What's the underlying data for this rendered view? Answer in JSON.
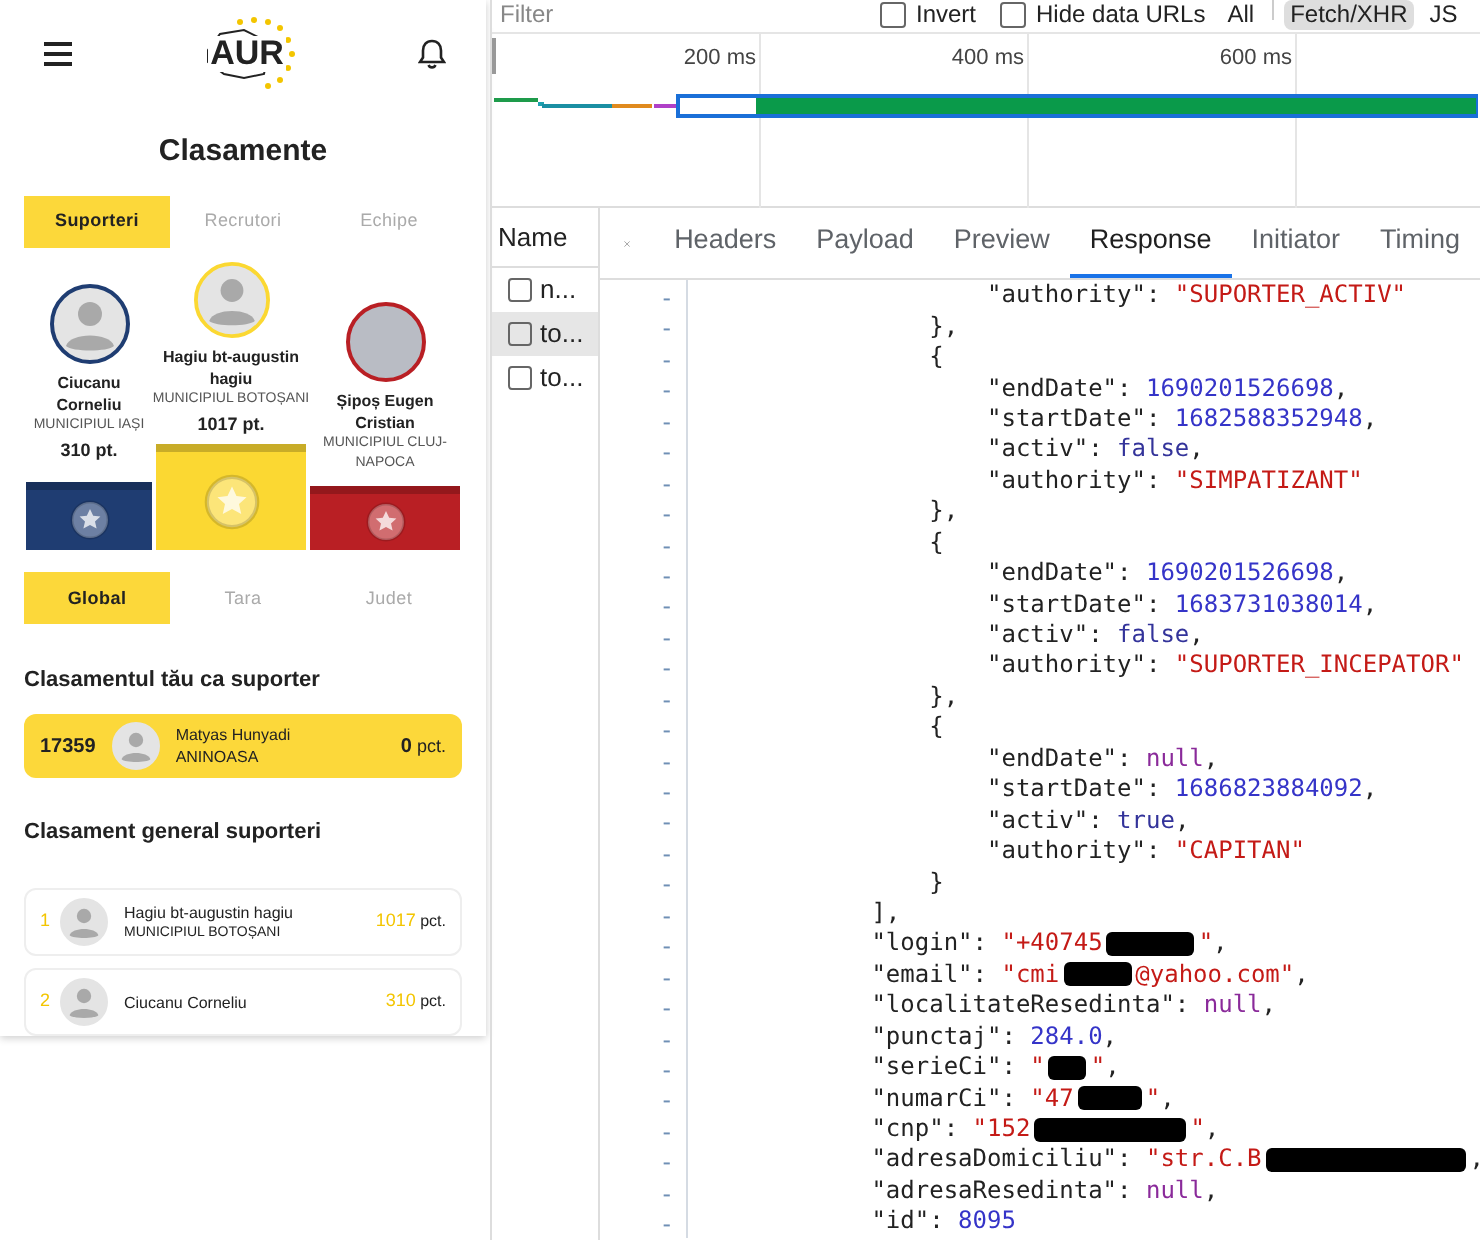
{
  "app": {
    "logo_text": "AUR",
    "title": "Clasamente",
    "category_tabs": [
      {
        "label": "Suporteri",
        "selected": true
      },
      {
        "label": "Recrutori",
        "selected": false
      },
      {
        "label": "Echipe",
        "selected": false
      }
    ],
    "podium": [
      {
        "name": "Ciucanu Corneliu",
        "city": "MUNICIPIUL IAȘI",
        "points": "310 pt.",
        "color": "#1f3d72",
        "kind": "silhouette"
      },
      {
        "name": "Hagiu bt-augustin hagiu",
        "city": "MUNICIPIUL BOTOȘANI",
        "points": "1017 pt.",
        "color": "#fbd832",
        "kind": "silhouette"
      },
      {
        "name": "Șipoș Eugen Cristian",
        "city": "MUNICIPIUL CLUJ-NAPOCA",
        "color": "#b91f24",
        "kind": "photo"
      }
    ],
    "scope_tabs": [
      {
        "label": "Global",
        "selected": true
      },
      {
        "label": "Tara",
        "selected": false
      },
      {
        "label": "Judet",
        "selected": false
      }
    ],
    "my_rank": {
      "heading": "Clasamentul tău ca suporter",
      "rank": "17359",
      "name": "Matyas Hunyadi",
      "city": "ANINOASA",
      "score": "0",
      "unit": "pct."
    },
    "general": {
      "heading": "Clasament general suporteri",
      "rows": [
        {
          "rank": "1",
          "name": "Hagiu bt-augustin hagiu",
          "city": "MUNICIPIUL BOTOȘANI",
          "score": "1017",
          "unit": "pct."
        },
        {
          "rank": "2",
          "name": "Ciucanu Corneliu",
          "score": "310",
          "unit": "pct."
        }
      ]
    }
  },
  "devtools": {
    "filter": {
      "placeholder": "Filter"
    },
    "checkboxes": [
      {
        "label": "Invert",
        "checked": false
      },
      {
        "label": "Hide data URLs",
        "checked": false
      }
    ],
    "type_filters": [
      {
        "label": "All",
        "selected": false
      },
      {
        "label": "Fetch/XHR",
        "selected": true
      },
      {
        "label": "JS",
        "selected": false
      }
    ],
    "overview": {
      "ticks": [
        "200 ms",
        "400 ms",
        "600 ms"
      ]
    },
    "requests_header": "Name",
    "requests": [
      {
        "label": "n...",
        "selected": false
      },
      {
        "label": "to...",
        "selected": true
      },
      {
        "label": "to...",
        "selected": false
      }
    ],
    "detail_tabs": [
      {
        "label": "Headers",
        "selected": false
      },
      {
        "label": "Payload",
        "selected": false
      },
      {
        "label": "Preview",
        "selected": false
      },
      {
        "label": "Response",
        "selected": true
      },
      {
        "label": "Initiator",
        "selected": false
      },
      {
        "label": "Timing",
        "selected": false
      }
    ],
    "response_lines": [
      {
        "marker": "-",
        "tokens": [
          {
            "kind": "key",
            "text": "                    \"authority\""
          },
          {
            "kind": "punct",
            "text": ": "
          },
          {
            "kind": "string",
            "text": "\"SUPORTER_ACTIV\""
          }
        ]
      },
      {
        "marker": "-",
        "tokens": [
          {
            "kind": "punct",
            "text": "                },"
          }
        ]
      },
      {
        "marker": "-",
        "tokens": [
          {
            "kind": "punct",
            "text": "                {"
          }
        ]
      },
      {
        "marker": "-",
        "tokens": [
          {
            "kind": "key",
            "text": "                    \"endDate\""
          },
          {
            "kind": "punct",
            "text": ": "
          },
          {
            "kind": "number",
            "text": "1690201526698"
          },
          {
            "kind": "punct",
            "text": ","
          }
        ]
      },
      {
        "marker": "-",
        "tokens": [
          {
            "kind": "key",
            "text": "                    \"startDate\""
          },
          {
            "kind": "punct",
            "text": ": "
          },
          {
            "kind": "number",
            "text": "1682588352948"
          },
          {
            "kind": "punct",
            "text": ","
          }
        ]
      },
      {
        "marker": "-",
        "tokens": [
          {
            "kind": "key",
            "text": "                    \"activ\""
          },
          {
            "kind": "punct",
            "text": ": "
          },
          {
            "kind": "boolean",
            "text": "false"
          },
          {
            "kind": "punct",
            "text": ","
          }
        ]
      },
      {
        "marker": "-",
        "tokens": [
          {
            "kind": "key",
            "text": "                    \"authority\""
          },
          {
            "kind": "punct",
            "text": ": "
          },
          {
            "kind": "string",
            "text": "\"SIMPATIZANT\""
          }
        ]
      },
      {
        "marker": "-",
        "tokens": [
          {
            "kind": "punct",
            "text": "                },"
          }
        ]
      },
      {
        "marker": "-",
        "tokens": [
          {
            "kind": "punct",
            "text": "                {"
          }
        ]
      },
      {
        "marker": "-",
        "tokens": [
          {
            "kind": "key",
            "text": "                    \"endDate\""
          },
          {
            "kind": "punct",
            "text": ": "
          },
          {
            "kind": "number",
            "text": "1690201526698"
          },
          {
            "kind": "punct",
            "text": ","
          }
        ]
      },
      {
        "marker": "-",
        "tokens": [
          {
            "kind": "key",
            "text": "                    \"startDate\""
          },
          {
            "kind": "punct",
            "text": ": "
          },
          {
            "kind": "number",
            "text": "1683731038014"
          },
          {
            "kind": "punct",
            "text": ","
          }
        ]
      },
      {
        "marker": "-",
        "tokens": [
          {
            "kind": "key",
            "text": "                    \"activ\""
          },
          {
            "kind": "punct",
            "text": ": "
          },
          {
            "kind": "boolean",
            "text": "false"
          },
          {
            "kind": "punct",
            "text": ","
          }
        ]
      },
      {
        "marker": "-",
        "tokens": [
          {
            "kind": "key",
            "text": "                    \"authority\""
          },
          {
            "kind": "punct",
            "text": ": "
          },
          {
            "kind": "string",
            "text": "\"SUPORTER_INCEPATOR\""
          }
        ]
      },
      {
        "marker": "-",
        "tokens": [
          {
            "kind": "punct",
            "text": "                },"
          }
        ]
      },
      {
        "marker": "-",
        "tokens": [
          {
            "kind": "punct",
            "text": "                {"
          }
        ]
      },
      {
        "marker": "-",
        "tokens": [
          {
            "kind": "key",
            "text": "                    \"endDate\""
          },
          {
            "kind": "punct",
            "text": ": "
          },
          {
            "kind": "null",
            "text": "null"
          },
          {
            "kind": "punct",
            "text": ","
          }
        ]
      },
      {
        "marker": "-",
        "tokens": [
          {
            "kind": "key",
            "text": "                    \"startDate\""
          },
          {
            "kind": "punct",
            "text": ": "
          },
          {
            "kind": "number",
            "text": "1686823884092"
          },
          {
            "kind": "punct",
            "text": ","
          }
        ]
      },
      {
        "marker": "-",
        "tokens": [
          {
            "kind": "key",
            "text": "                    \"activ\""
          },
          {
            "kind": "punct",
            "text": ": "
          },
          {
            "kind": "boolean",
            "text": "true"
          },
          {
            "kind": "punct",
            "text": ","
          }
        ]
      },
      {
        "marker": "-",
        "tokens": [
          {
            "kind": "key",
            "text": "                    \"authority\""
          },
          {
            "kind": "punct",
            "text": ": "
          },
          {
            "kind": "string",
            "text": "\"CAPITAN\""
          }
        ]
      },
      {
        "marker": "-",
        "tokens": [
          {
            "kind": "punct",
            "text": "                }"
          }
        ]
      },
      {
        "marker": "-",
        "tokens": [
          {
            "kind": "punct",
            "text": "            ],"
          }
        ]
      },
      {
        "marker": "-",
        "tokens": [
          {
            "kind": "key",
            "text": "            \"login\""
          },
          {
            "kind": "punct",
            "text": ": "
          },
          {
            "kind": "string",
            "text": "\"+40745"
          },
          {
            "kind": "redacted"
          },
          {
            "kind": "string",
            "text": "\""
          },
          {
            "kind": "punct",
            "text": ","
          }
        ]
      },
      {
        "marker": "-",
        "tokens": [
          {
            "kind": "key",
            "text": "            \"email\""
          },
          {
            "kind": "punct",
            "text": ": "
          },
          {
            "kind": "string",
            "text": "\"cmi"
          },
          {
            "kind": "redacted"
          },
          {
            "kind": "string",
            "text": "@yahoo.com\""
          },
          {
            "kind": "punct",
            "text": ","
          }
        ]
      },
      {
        "marker": "-",
        "tokens": [
          {
            "kind": "key",
            "text": "            \"localitateResedinta\""
          },
          {
            "kind": "punct",
            "text": ": "
          },
          {
            "kind": "null",
            "text": "null"
          },
          {
            "kind": "punct",
            "text": ","
          }
        ]
      },
      {
        "marker": "-",
        "tokens": [
          {
            "kind": "key",
            "text": "            \"punctaj\""
          },
          {
            "kind": "punct",
            "text": ": "
          },
          {
            "kind": "number",
            "text": "284.0"
          },
          {
            "kind": "punct",
            "text": ","
          }
        ]
      },
      {
        "marker": "-",
        "tokens": [
          {
            "kind": "key",
            "text": "            \"serieCi\""
          },
          {
            "kind": "punct",
            "text": ": "
          },
          {
            "kind": "string",
            "text": "\""
          },
          {
            "kind": "redacted"
          },
          {
            "kind": "string",
            "text": "\""
          },
          {
            "kind": "punct",
            "text": ","
          }
        ]
      },
      {
        "marker": "-",
        "tokens": [
          {
            "kind": "key",
            "text": "            \"numarCi\""
          },
          {
            "kind": "punct",
            "text": ": "
          },
          {
            "kind": "string",
            "text": "\"47"
          },
          {
            "kind": "redacted"
          },
          {
            "kind": "string",
            "text": "\""
          },
          {
            "kind": "punct",
            "text": ","
          }
        ]
      },
      {
        "marker": "-",
        "tokens": [
          {
            "kind": "key",
            "text": "            \"cnp\""
          },
          {
            "kind": "punct",
            "text": ": "
          },
          {
            "kind": "string",
            "text": "\"152"
          },
          {
            "kind": "redacted"
          },
          {
            "kind": "string",
            "text": "\""
          },
          {
            "kind": "punct",
            "text": ","
          }
        ]
      },
      {
        "marker": "-",
        "tokens": [
          {
            "kind": "key",
            "text": "            \"adresaDomiciliu\""
          },
          {
            "kind": "punct",
            "text": ": "
          },
          {
            "kind": "string",
            "text": "\"str.C.B"
          },
          {
            "kind": "redacted"
          },
          {
            "kind": "punct",
            "text": ","
          }
        ]
      },
      {
        "marker": "-",
        "tokens": [
          {
            "kind": "key",
            "text": "            \"adresaResedinta\""
          },
          {
            "kind": "punct",
            "text": ": "
          },
          {
            "kind": "null",
            "text": "null"
          },
          {
            "kind": "punct",
            "text": ","
          }
        ]
      },
      {
        "marker": "-",
        "tokens": [
          {
            "kind": "key",
            "text": "            \"id\""
          },
          {
            "kind": "punct",
            "text": ": "
          },
          {
            "kind": "number",
            "text": "8095"
          }
        ]
      }
    ]
  }
}
